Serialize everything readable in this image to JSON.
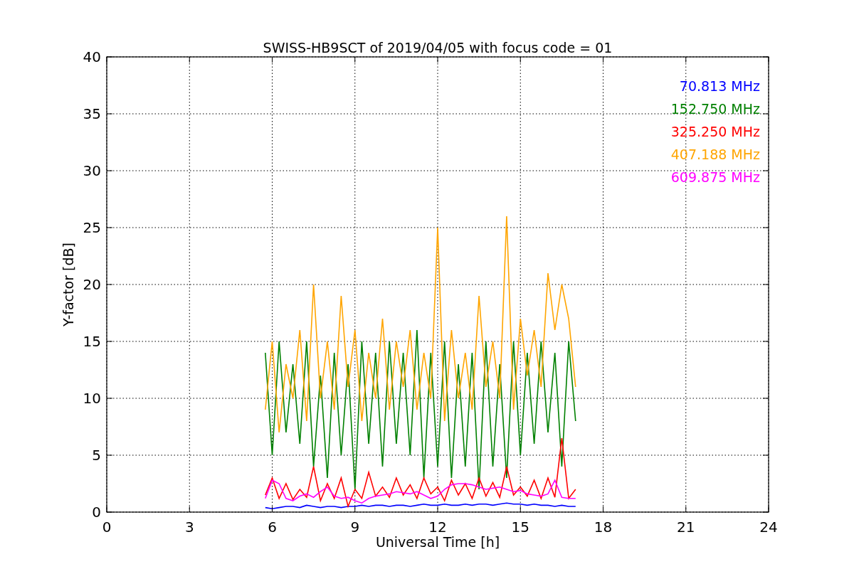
{
  "chart_data": {
    "type": "line",
    "grid": true,
    "title": "SWISS-HB9SCT of 2019/04/05 with focus code = 01",
    "xlabel": "Universal Time [h]",
    "ylabel": "Y-factor [dB]",
    "xlim": [
      0,
      24
    ],
    "ylim": [
      0,
      40
    ],
    "xticks": [
      0,
      3,
      6,
      9,
      12,
      15,
      18,
      21,
      24
    ],
    "yticks": [
      0,
      5,
      10,
      15,
      20,
      25,
      30,
      35,
      40
    ],
    "x": [
      5.75,
      6,
      6.25,
      6.5,
      6.75,
      7,
      7.25,
      7.5,
      7.75,
      8,
      8.25,
      8.5,
      8.75,
      9,
      9.25,
      9.5,
      9.75,
      10,
      10.25,
      10.5,
      10.75,
      11,
      11.25,
      11.5,
      11.75,
      12,
      12.25,
      12.5,
      12.75,
      13,
      13.25,
      13.5,
      13.75,
      14,
      14.25,
      14.5,
      14.75,
      15,
      15.25,
      15.5,
      15.75,
      16,
      16.25,
      16.5,
      16.75,
      17
    ],
    "series": [
      {
        "name": "70.813 MHz",
        "color": "#0000ff",
        "values": [
          0.4,
          0.3,
          0.4,
          0.5,
          0.5,
          0.4,
          0.6,
          0.5,
          0.4,
          0.5,
          0.5,
          0.4,
          0.5,
          0.5,
          0.6,
          0.5,
          0.6,
          0.6,
          0.5,
          0.6,
          0.6,
          0.5,
          0.6,
          0.7,
          0.6,
          0.6,
          0.7,
          0.6,
          0.6,
          0.7,
          0.6,
          0.7,
          0.7,
          0.6,
          0.7,
          0.8,
          0.7,
          0.7,
          0.6,
          0.7,
          0.6,
          0.6,
          0.5,
          0.6,
          0.5,
          0.5
        ]
      },
      {
        "name": "152.750 MHz",
        "color": "#008000",
        "values": [
          14,
          5,
          15,
          7,
          13,
          6,
          15,
          4,
          12,
          3,
          14,
          5,
          13,
          2,
          15,
          6,
          14,
          4,
          15,
          6,
          14,
          5,
          16,
          3,
          14,
          4,
          15,
          3,
          13,
          4,
          14,
          2,
          15,
          4,
          13,
          3,
          15,
          5,
          14,
          6,
          15,
          7,
          14,
          4,
          15,
          8
        ]
      },
      {
        "name": "325.250 MHz",
        "color": "#ff0000",
        "values": [
          1.5,
          3,
          1.2,
          2.5,
          1.1,
          2,
          1.3,
          4,
          1,
          2.5,
          1.2,
          3,
          0.5,
          2,
          1.2,
          3.5,
          1.4,
          2.2,
          1.3,
          3,
          1.5,
          2.4,
          1.2,
          3,
          1.6,
          2.2,
          1,
          2.8,
          1.5,
          2.5,
          1.2,
          3,
          1.4,
          2.6,
          1.3,
          4,
          1.5,
          2.2,
          1.4,
          2.8,
          1.2,
          3,
          1.3,
          6.5,
          1.2,
          2
        ]
      },
      {
        "name": "407.188 MHz",
        "color": "#ffa500",
        "values": [
          9,
          15,
          7,
          13,
          10,
          16,
          8,
          20,
          10,
          15,
          9,
          19,
          11,
          16,
          8,
          14,
          10,
          17,
          9,
          15,
          11,
          16,
          9,
          14,
          10,
          25,
          8,
          16,
          10,
          14,
          9,
          19,
          11,
          15,
          10,
          26,
          9,
          17,
          12,
          16,
          11,
          21,
          16,
          20,
          17,
          11
        ]
      },
      {
        "name": "609.875 MHz",
        "color": "#ff00ff",
        "values": [
          1.2,
          2.8,
          2.5,
          1.2,
          1,
          1.4,
          1.6,
          1.3,
          1.8,
          2.2,
          1.4,
          1.2,
          1.3,
          1.0,
          0.8,
          1.2,
          1.4,
          1.5,
          1.6,
          1.8,
          1.7,
          1.6,
          1.8,
          1.5,
          1.2,
          1.4,
          2.0,
          2.4,
          2.5,
          2.5,
          2.4,
          2.2,
          2.0,
          2.1,
          2.2,
          2.0,
          1.8,
          1.9,
          1.6,
          1.5,
          1.4,
          1.6,
          2.8,
          1.3,
          1.2,
          1.2
        ]
      }
    ]
  }
}
